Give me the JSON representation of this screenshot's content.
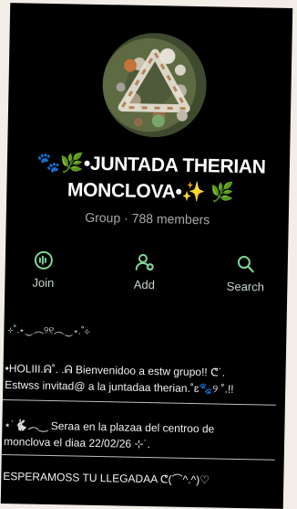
{
  "group": {
    "title_line1": "🐾🌿•JUNTADA THERIAN",
    "title_line2": "MONCLOVA•✨ 🌿",
    "type": "Group",
    "separator": "·",
    "members": "788 members"
  },
  "actions": [
    {
      "label": "Join",
      "icon": "join-icon"
    },
    {
      "label": "Add",
      "icon": "add-person-icon"
    },
    {
      "label": "Search",
      "icon": "search-icon"
    }
  ],
  "description": {
    "divider_top": "⊹˚.⋆‿︵୨୧︵‿⋆.˚⊹",
    "line1": "•HOLIII.ᕱ˚. .ᕱ  Bienvenidoo a estw grupo!! ᕦ˙.",
    "line2": "Estwss invitad@ a la juntadaa therian.˚ɛ🐾୨ ˚.!!",
    "line3": "⋆˙🐇︵‿  Seraa en la plazaa del centroo de",
    "line4": "monclova el diaa 22/02/26 ⊹˙.",
    "line5": "ESPERAMOSS TU LLEGADAA ᕦ(⌒^.^)♡"
  },
  "colors": {
    "background": "#000000",
    "icon_green": "#7fd39a",
    "muted_text": "#a8a8a8"
  }
}
